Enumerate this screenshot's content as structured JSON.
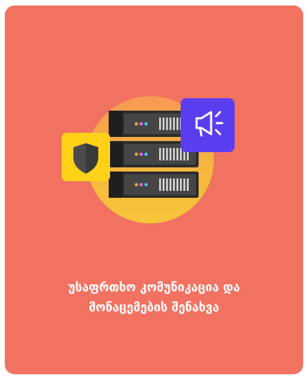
{
  "card": {
    "background_color": "#F27261",
    "title_line_1": "უსაფრთხო კომუნიკაცია და",
    "title_line_2": "მონაცემების შენახვა"
  },
  "illustration": {
    "server_units": 3,
    "shield_badge_color": "#FFD218",
    "megaphone_badge_color": "#5B3DF0",
    "server_indicator_colors": [
      "#F2A33A",
      "#E46BE0",
      "#43C5F0"
    ],
    "icons": [
      "server-rack-icon",
      "shield-icon",
      "megaphone-icon"
    ]
  }
}
